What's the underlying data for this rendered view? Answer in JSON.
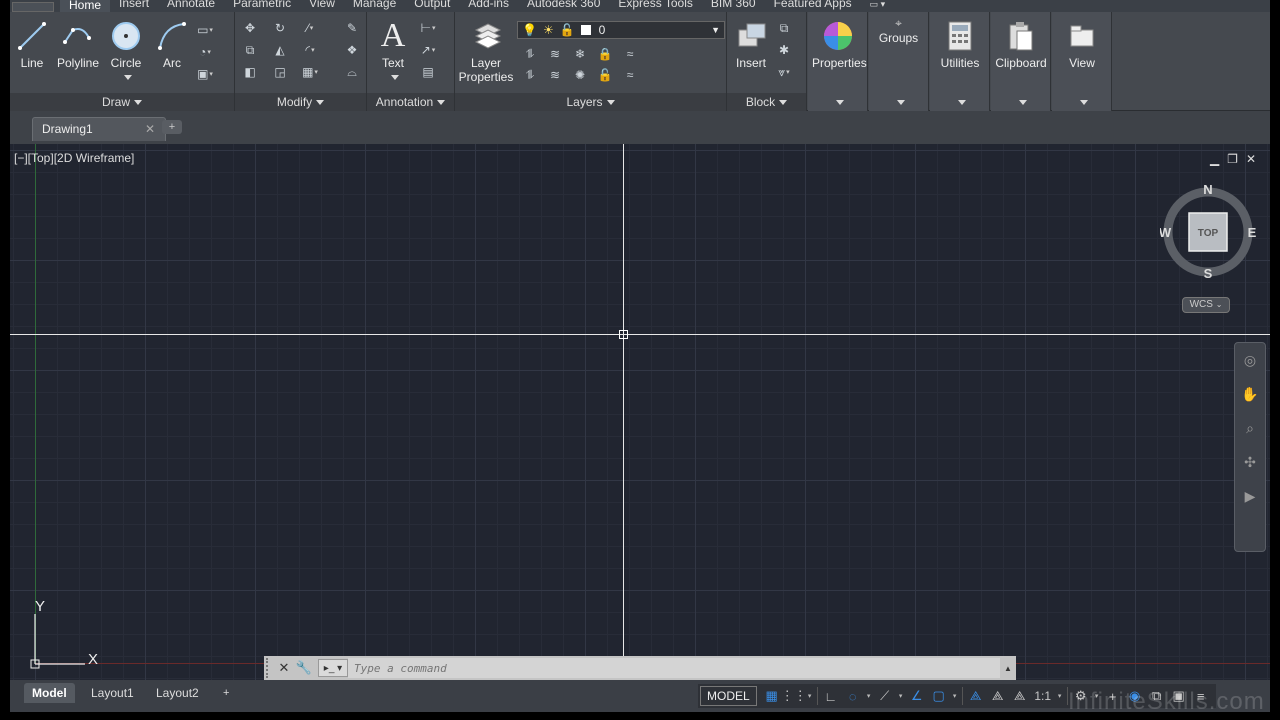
{
  "ribbon_tabs": [
    "Home",
    "Insert",
    "Annotate",
    "Parametric",
    "View",
    "Manage",
    "Output",
    "Add-ins",
    "Autodesk 360",
    "Express Tools",
    "BIM 360",
    "Featured Apps"
  ],
  "draw_panel": {
    "title": "Draw",
    "tools": [
      "Line",
      "Polyline",
      "Circle",
      "Arc"
    ]
  },
  "modify_panel": {
    "title": "Modify"
  },
  "annotation_panel": {
    "title": "Annotation",
    "text_label": "Text"
  },
  "layers_panel": {
    "title": "Layers",
    "layer_props_line1": "Layer",
    "layer_props_line2": "Properties",
    "current_layer": "0"
  },
  "block_panel": {
    "title": "Block",
    "insert_label": "Insert"
  },
  "other_panels": [
    "Properties",
    "Groups",
    "Utilities",
    "Clipboard",
    "View"
  ],
  "document": {
    "tab_name": "Drawing1",
    "new_tab": "+"
  },
  "viewport": {
    "label": "[−][Top][2D Wireframe]",
    "controls": [
      "▁",
      "❐",
      "✕"
    ]
  },
  "viewcube": {
    "north": "N",
    "south": "S",
    "east": "E",
    "west": "W",
    "face": "TOP",
    "wcs": "WCS"
  },
  "ucs": {
    "x": "X",
    "y": "Y"
  },
  "command": {
    "placeholder": "Type a command"
  },
  "layout_tabs": [
    "Model",
    "Layout1",
    "Layout2"
  ],
  "status": {
    "model": "MODEL",
    "scale": "1:1"
  },
  "colors": {
    "canvas": "#212530",
    "ribbon": "#45494f",
    "accent": "#3a8ee6"
  },
  "watermark": "InfiniteSkills.com"
}
